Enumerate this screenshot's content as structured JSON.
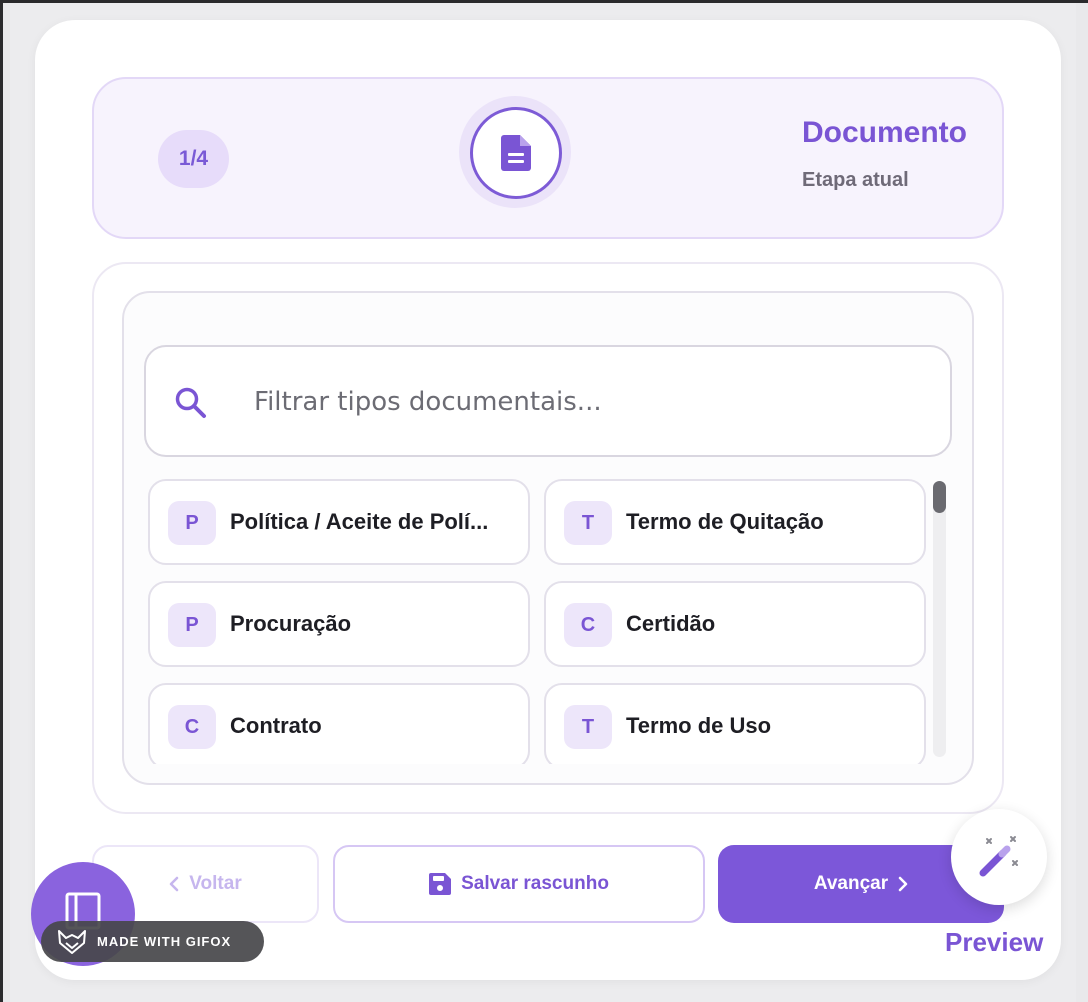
{
  "stepper": {
    "step_indicator": "1/4",
    "step_title": "Documento",
    "step_subtitle": "Etapa atual",
    "step_icon": "document-icon"
  },
  "search": {
    "placeholder": "Filtrar tipos documentais...",
    "value": "",
    "icon": "search-icon"
  },
  "document_types": [
    {
      "letter": "P",
      "label": "Política / Aceite de Polí..."
    },
    {
      "letter": "T",
      "label": "Termo de Quitação"
    },
    {
      "letter": "P",
      "label": "Procuração"
    },
    {
      "letter": "C",
      "label": "Certidão"
    },
    {
      "letter": "C",
      "label": "Contrato"
    },
    {
      "letter": "T",
      "label": "Termo de Uso"
    }
  ],
  "actions": {
    "back_label": "Voltar",
    "draft_label": "Salvar rascunho",
    "next_label": "Avançar"
  },
  "preview_label": "Preview",
  "watermark": "MADE WITH GIFOX",
  "colors": {
    "accent": "#7c57d9",
    "accent_light": "#ede6fa",
    "stepper_bg": "#f7f3fd",
    "text_dark": "#1e1e24"
  }
}
